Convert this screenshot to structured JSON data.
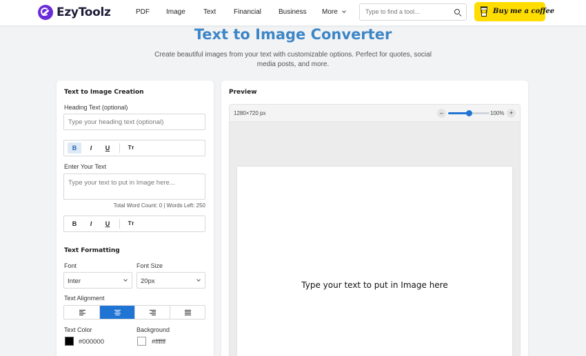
{
  "header": {
    "logo_text": "EzyToolz",
    "nav": [
      "PDF",
      "Image",
      "Text",
      "Financial",
      "Business",
      "More"
    ],
    "search_placeholder": "Type to find a tool...",
    "coffee_label": "Buy me a coffee"
  },
  "page": {
    "title": "Text to Image Converter",
    "subtitle": "Create beautiful images from your text with customizable options. Perfect for quotes, social media posts, and more."
  },
  "left": {
    "section_title": "Text to Image Creation",
    "heading_label": "Heading Text (optional)",
    "heading_placeholder": "Type your heading text (optional)",
    "toolbar": {
      "bold": "B",
      "italic": "I",
      "underline": "U",
      "size": "Tт"
    },
    "text_label": "Enter Your Text",
    "text_placeholder": "Type your text to put in Image here...",
    "word_count": "Total Word Count: 0 | Words Left: 250",
    "formatting_title": "Text Formatting",
    "font_label": "Font",
    "font_value": "Inter",
    "size_label": "Font Size",
    "size_value": "20px",
    "alignment_label": "Text Alignment",
    "alignment_active": "center",
    "text_color_label": "Text Color",
    "text_color_value": "#000000",
    "bg_label": "Background",
    "bg_value": "#ffffff"
  },
  "preview": {
    "title": "Preview",
    "dimensions": "1280×720 px",
    "zoom_minus": "–",
    "zoom_plus": "+",
    "zoom_value": "100%",
    "zoom_level": 0.5,
    "canvas_text": "Type your text to put in Image here"
  },
  "colors": {
    "accent": "#1f74d4",
    "title": "#3d86c6",
    "coffee": "#ffdd00",
    "logo": "#6a2bd9"
  }
}
